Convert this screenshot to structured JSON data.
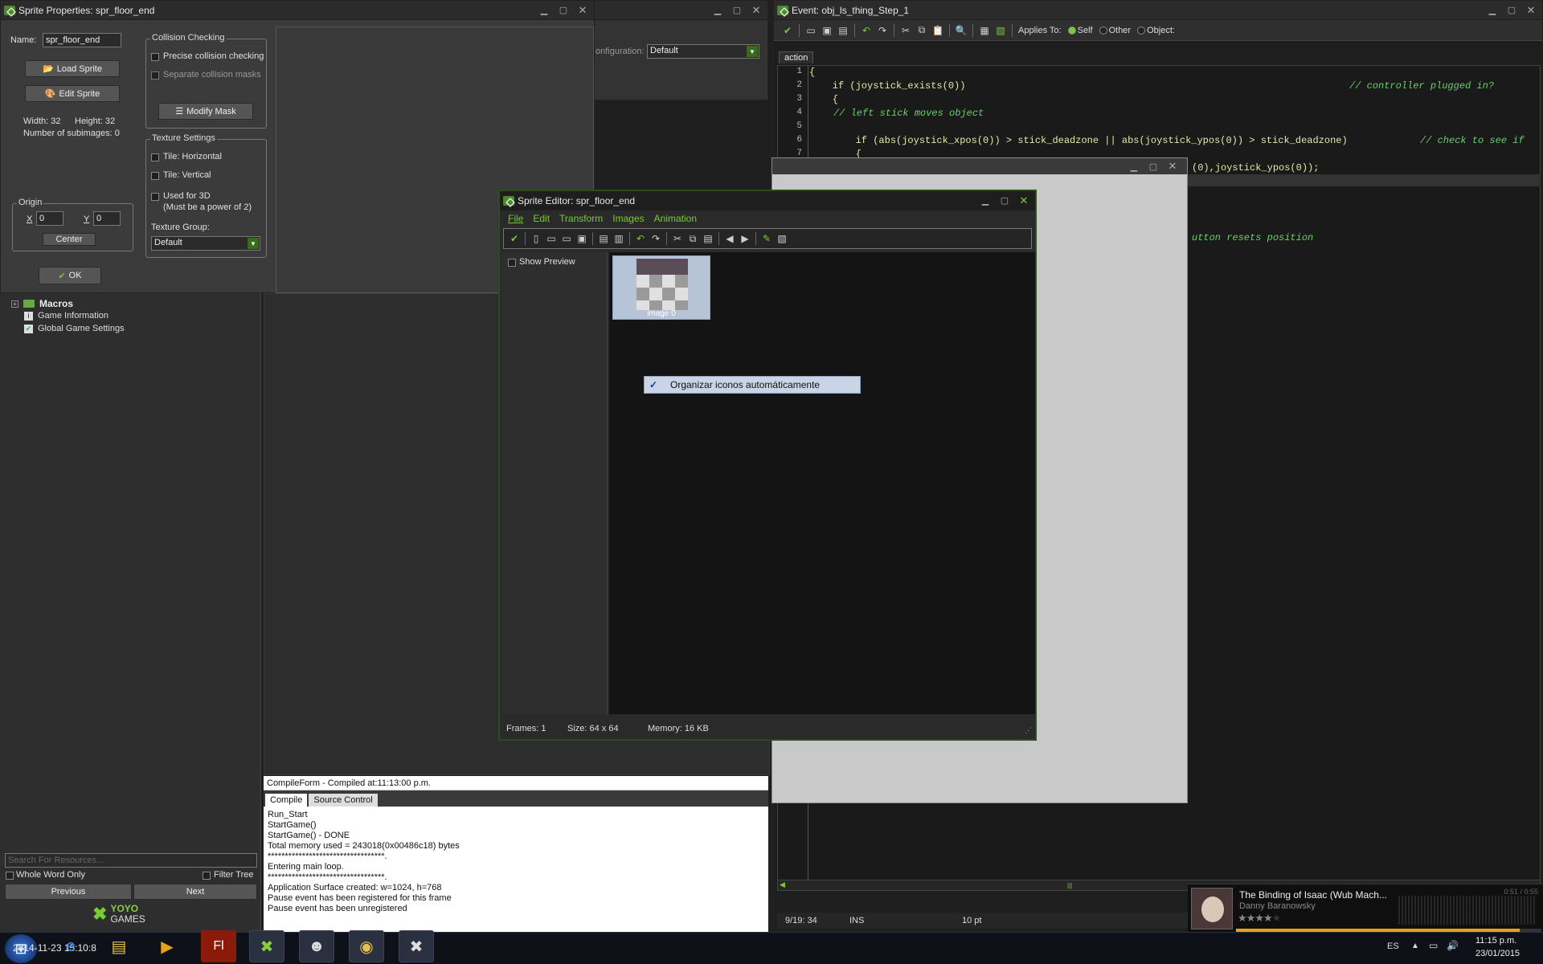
{
  "sprite_props": {
    "title": "Sprite Properties: spr_floor_end",
    "name_label": "Name:",
    "name_value": "spr_floor_end",
    "load_sprite": "Load Sprite",
    "edit_sprite": "Edit Sprite",
    "width_label": "Width: 32",
    "height_label": "Height: 32",
    "subimages": "Number of subimages: 0",
    "origin_group": "Origin",
    "x_label": "X",
    "x_value": "0",
    "y_label": "Y",
    "y_value": "0",
    "center": "Center",
    "ok": "OK",
    "collision_group": "Collision Checking",
    "precise": "Precise collision checking",
    "separate": "Separate collision masks",
    "modify_mask": "Modify Mask",
    "texture_group": "Texture Settings",
    "tile_h": "Tile: Horizontal",
    "tile_v": "Tile: Vertical",
    "used3d": "Used for 3D",
    "used3d_note": "(Must be a power of 2)",
    "tex_group_label": "Texture Group:",
    "tex_group_value": "Default"
  },
  "config": {
    "label": "onfiguration:",
    "value": "Default"
  },
  "tree": {
    "items": [
      "Macros",
      "Game Information",
      "Global Game Settings"
    ],
    "search_placeholder": "Search For Resources...",
    "whole_word": "Whole Word Only",
    "filter_tree": "Filter Tree",
    "previous": "Previous",
    "next": "Next",
    "logo_top": "YOYO",
    "logo_bottom": "GAMES"
  },
  "compile": {
    "title": "CompileForm - Compiled at:11:13:00 p.m.",
    "tabs": [
      "Compile",
      "Source Control"
    ],
    "lines": [
      "Run_Start",
      "StartGame()",
      "StartGame() - DONE",
      "Total memory used = 243018(0x00486c18) bytes",
      "**********************************.",
      "Entering main loop.",
      "**********************************.",
      "Application Surface created: w=1024, h=768",
      "Pause event has been registered for this frame",
      "Pause event has been unregistered"
    ]
  },
  "event": {
    "title": "Event: obj_ls_thing_Step_1",
    "applies_to": "Applies To:",
    "self": "Self",
    "other": "Other",
    "object": "Object:",
    "tab": "action",
    "line_numbers": [
      "1",
      "2",
      "3",
      "4",
      "5",
      "6",
      "7"
    ],
    "code": [
      "{",
      "    if (joystick_exists(0))",
      "    {",
      "",
      "",
      "        if (abs(joystick_xpos(0)) > stick_deadzone || abs(joystick_ypos(0)) > stick_deadzone)",
      "        {"
    ],
    "comment_1": "// controller plugged in?",
    "comment_4": "// left stick moves object",
    "comment_6": "// check to see if",
    "partial_line": "(0),joystick_ypos(0));",
    "partial_comment": "utton resets position",
    "status_pos": "9/19:  34",
    "status_ins": "INS",
    "status_pt": "10 pt"
  },
  "sprite_editor": {
    "title": "Sprite Editor: spr_floor_end",
    "menu": [
      "File",
      "Edit",
      "Transform",
      "Images",
      "Animation"
    ],
    "show_preview": "Show Preview",
    "image_label": "image 0",
    "context_item": "Organizar iconos automáticamente",
    "frames": "Frames: 1",
    "size": "Size: 64 x 64",
    "memory": "Memory: 16 KB"
  },
  "media": {
    "song": "The Binding of Isaac (Wub Mach...",
    "artist": "Danny Baranowsky",
    "time": "0:51 / 0:55",
    "rating": 4
  },
  "taskbar": {
    "lang": "ES",
    "time": "11:15 p.m.",
    "date": "23/01/2015",
    "overlay": "2014-11-23 15:10:8"
  }
}
